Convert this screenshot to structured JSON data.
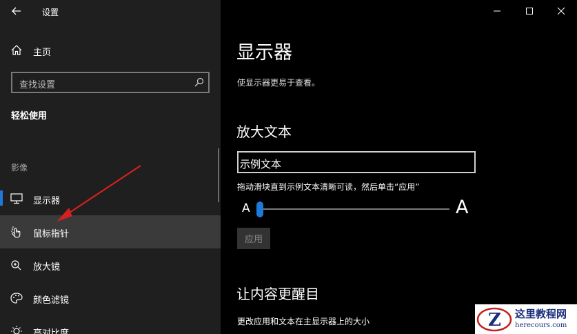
{
  "window": {
    "title": "设置"
  },
  "sidebar": {
    "home_label": "主页",
    "search_placeholder": "查找设置",
    "section_title": "轻松使用",
    "group_label": "影像",
    "items": [
      {
        "label": "显示器",
        "icon": "monitor-icon",
        "selected": true
      },
      {
        "label": "鼠标指针",
        "icon": "pointer-icon",
        "hovered": true
      },
      {
        "label": "放大镜",
        "icon": "magnifier-icon"
      },
      {
        "label": "颜色滤镜",
        "icon": "palette-icon"
      },
      {
        "label": "高对比度",
        "icon": "contrast-icon"
      }
    ]
  },
  "main": {
    "title": "显示器",
    "subtitle": "使显示器更易于查看。",
    "enlarge_heading": "放大文本",
    "sample_text": "示例文本",
    "hint": "拖动滑块直到示例文本清晰可读，然后单击“应用”",
    "slider_min_label": "A",
    "slider_max_label": "A",
    "slider_value_fraction": 0.0,
    "apply_label": "应用",
    "bright_heading": "让内容更醒目",
    "bright_sub": "更改应用和文本在主显示器上的大小"
  },
  "watermark": {
    "title": "这里教程网",
    "url": "herecours.com"
  },
  "colors": {
    "accent": "#1e7ad9",
    "sidebar_bg": "#1f1f1f",
    "main_bg": "#000000",
    "annotation": "#d42020"
  }
}
